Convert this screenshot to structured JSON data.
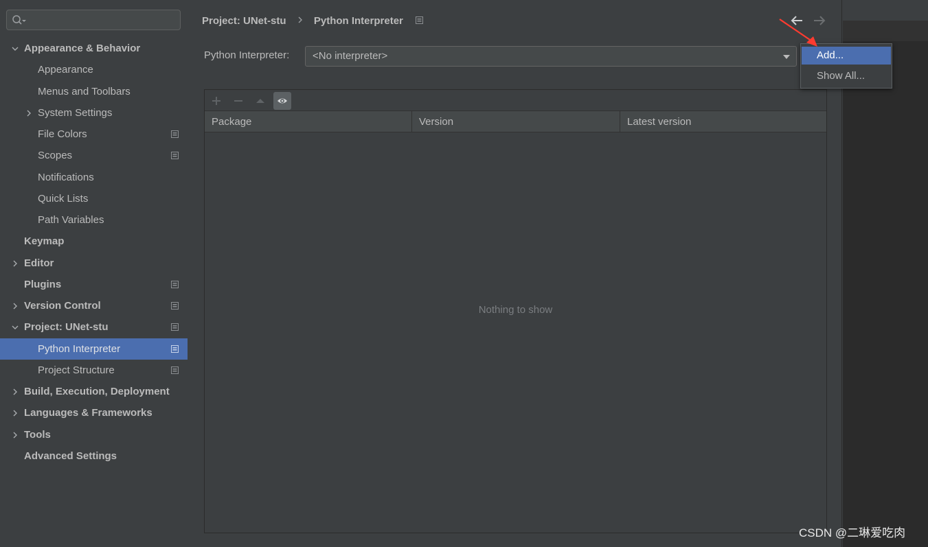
{
  "search": {
    "value": ""
  },
  "sidebar": {
    "items": [
      {
        "label": "Appearance & Behavior",
        "level": 0,
        "expanded": true
      },
      {
        "label": "Appearance",
        "level": 1
      },
      {
        "label": "Menus and Toolbars",
        "level": 1
      },
      {
        "label": "System Settings",
        "level": 1,
        "collapsed": true
      },
      {
        "label": "File Colors",
        "level": 1,
        "project_icon": true
      },
      {
        "label": "Scopes",
        "level": 1,
        "project_icon": true
      },
      {
        "label": "Notifications",
        "level": 1
      },
      {
        "label": "Quick Lists",
        "level": 1
      },
      {
        "label": "Path Variables",
        "level": 1
      },
      {
        "label": "Keymap",
        "level": 0
      },
      {
        "label": "Editor",
        "level": 0,
        "collapsed": true
      },
      {
        "label": "Plugins",
        "level": 0,
        "project_icon": true
      },
      {
        "label": "Version Control",
        "level": 0,
        "collapsed": true,
        "project_icon": true
      },
      {
        "label": "Project: UNet-stu",
        "level": 0,
        "expanded": true,
        "project_icon": true
      },
      {
        "label": "Python Interpreter",
        "level": 1,
        "selected": true,
        "project_icon": true
      },
      {
        "label": "Project Structure",
        "level": 1,
        "project_icon": true
      },
      {
        "label": "Build, Execution, Deployment",
        "level": 0,
        "collapsed": true
      },
      {
        "label": "Languages & Frameworks",
        "level": 0,
        "collapsed": true
      },
      {
        "label": "Tools",
        "level": 0,
        "collapsed": true
      },
      {
        "label": "Advanced Settings",
        "level": 0
      }
    ]
  },
  "breadcrumb": {
    "parent": "Project: UNet-stu",
    "current": "Python Interpreter"
  },
  "interpreter": {
    "label": "Python Interpreter:",
    "value": "<No interpreter>"
  },
  "packages": {
    "columns": [
      "Package",
      "Version",
      "Latest version"
    ],
    "empty_text": "Nothing to show",
    "toolbar": [
      "add-icon",
      "remove-icon",
      "upgrade-icon",
      "eye-icon"
    ]
  },
  "popup": {
    "items": [
      "Add...",
      "Show All..."
    ],
    "selected": "Add..."
  },
  "watermark": "CSDN @二琳爱吃肉",
  "colors": {
    "background": "#3c3f41",
    "selection": "#4b6eaf",
    "annotation_arrow": "#ff3b30"
  }
}
